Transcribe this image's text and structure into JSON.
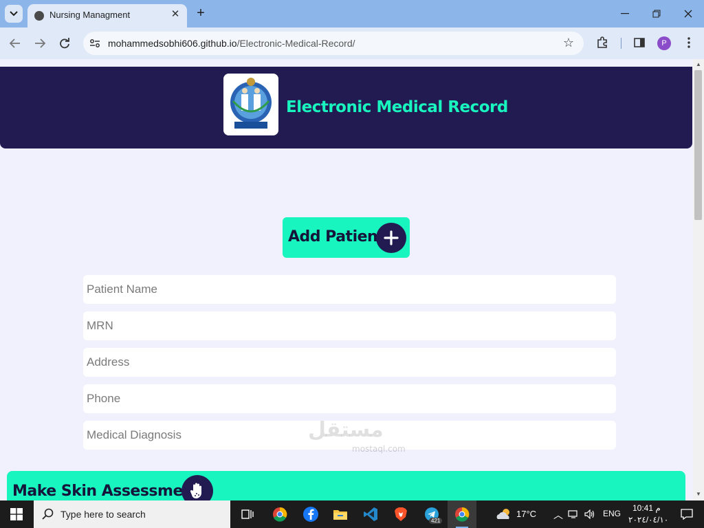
{
  "browser": {
    "tab_title": "Nursing Managment",
    "url_host": "mohammedsobhi606.github.io",
    "url_path": "/Electronic-Medical-Record/",
    "profile_initial": "P"
  },
  "page": {
    "header_title": "Electronic Medical Record",
    "add_patient_label": "Add Patient",
    "fields": {
      "patient_name": "Patient Name",
      "mrn": "MRN",
      "address": "Address",
      "phone": "Phone",
      "medical_diagnosis": "Medical Diagnosis"
    },
    "skin_assessment_label": "Make Skin Assessment",
    "watermark": "مستقل",
    "watermark_sub": "mostaql.com"
  },
  "taskbar": {
    "search_placeholder": "Type here to search",
    "telegram_badge": "421",
    "weather_temp": "17°C",
    "language": "ENG",
    "time": "10:41 م",
    "date": "٢٠٢٤/٠٤/١٠"
  },
  "colors": {
    "header_bg": "#221b52",
    "accent": "#19f5bf",
    "page_bg": "#f1f1fd"
  }
}
